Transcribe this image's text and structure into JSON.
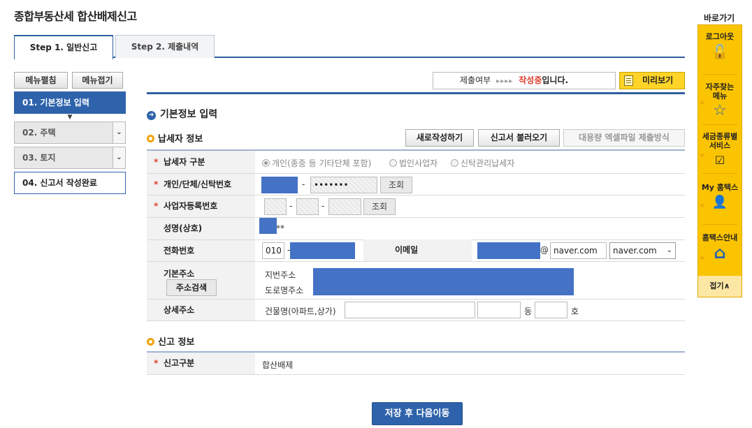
{
  "page": {
    "title": "종합부동산세 합산배제신고"
  },
  "tabs": [
    {
      "label": "Step 1. 일반신고",
      "active": true
    },
    {
      "label": "Step 2. 제출내역",
      "active": false
    }
  ],
  "menu_buttons": {
    "open_label": "메뉴펼침",
    "close_label": "메뉴접기"
  },
  "sidenav": {
    "items": [
      {
        "label": "01. 기본정보 입력",
        "state": "active"
      },
      {
        "label": "02. 주택",
        "state": "collapsed"
      },
      {
        "label": "03. 토지",
        "state": "collapsed"
      },
      {
        "label": "04. 신고서 작성완료",
        "state": "done"
      }
    ]
  },
  "status": {
    "label": "제출여부",
    "arrows": "▸▸▸▸",
    "active_word": "작성중",
    "suffix": "입니다."
  },
  "preview_label": "미리보기",
  "section_title": "기본정보 입력",
  "taxpayer": {
    "title": "납세자 정보",
    "buttons": {
      "new": "새로작성하기",
      "load": "신고서 불러오기",
      "bulk": "대용량 엑셀파일 제출방식"
    },
    "rows": {
      "type": {
        "label": "납세자 구분",
        "options": [
          "개인(종중 등 기타단체 포함)",
          "법인사업자",
          "신탁관리납세자"
        ],
        "selected": 0
      },
      "id": {
        "label": "개인/단체/신탁번호",
        "dash": "-",
        "masked": "•••••••",
        "lookup": "조회"
      },
      "bizno": {
        "label": "사업자등록번호",
        "dash": "-",
        "lookup": "조회"
      },
      "name": {
        "label": "성명(상호)",
        "suffix": "**"
      },
      "phone": {
        "label": "전화번호",
        "area": "010",
        "dash": "-",
        "email_label": "이메일",
        "at": "@",
        "domain": "naver.com",
        "domain_select": "naver.com"
      },
      "address": {
        "label": "기본주소",
        "search": "주소검색",
        "lot": "지번주소",
        "road": "도로명주소"
      },
      "detail": {
        "label": "상세주소",
        "building": "건물명(아파트,상가)",
        "dong": "동",
        "ho": "호"
      }
    }
  },
  "report": {
    "title": "신고 정보",
    "type_label": "신고구분",
    "type_value": "합산배제"
  },
  "save_label": "저장 후 다음이동",
  "quick": {
    "label": "바로가기",
    "items": [
      {
        "label": "로그아웃",
        "icon": "lock-open-icon",
        "glyph": "🔓"
      },
      {
        "label": "자주찾는 메뉴",
        "icon": "star-icon",
        "glyph": "☆"
      },
      {
        "label": "세금종류별 서비스",
        "icon": "check-box-icon",
        "glyph": "☑"
      },
      {
        "label": "My 홈택스",
        "icon": "person-icon",
        "glyph": "👤"
      },
      {
        "label": "홈택스안내",
        "icon": "home-guide-icon",
        "glyph": "⌂"
      }
    ],
    "fold": "접기∧"
  },
  "colors": {
    "accent": "#2e63ab",
    "highlight": "#fbc400",
    "required": "#e03c2c"
  }
}
